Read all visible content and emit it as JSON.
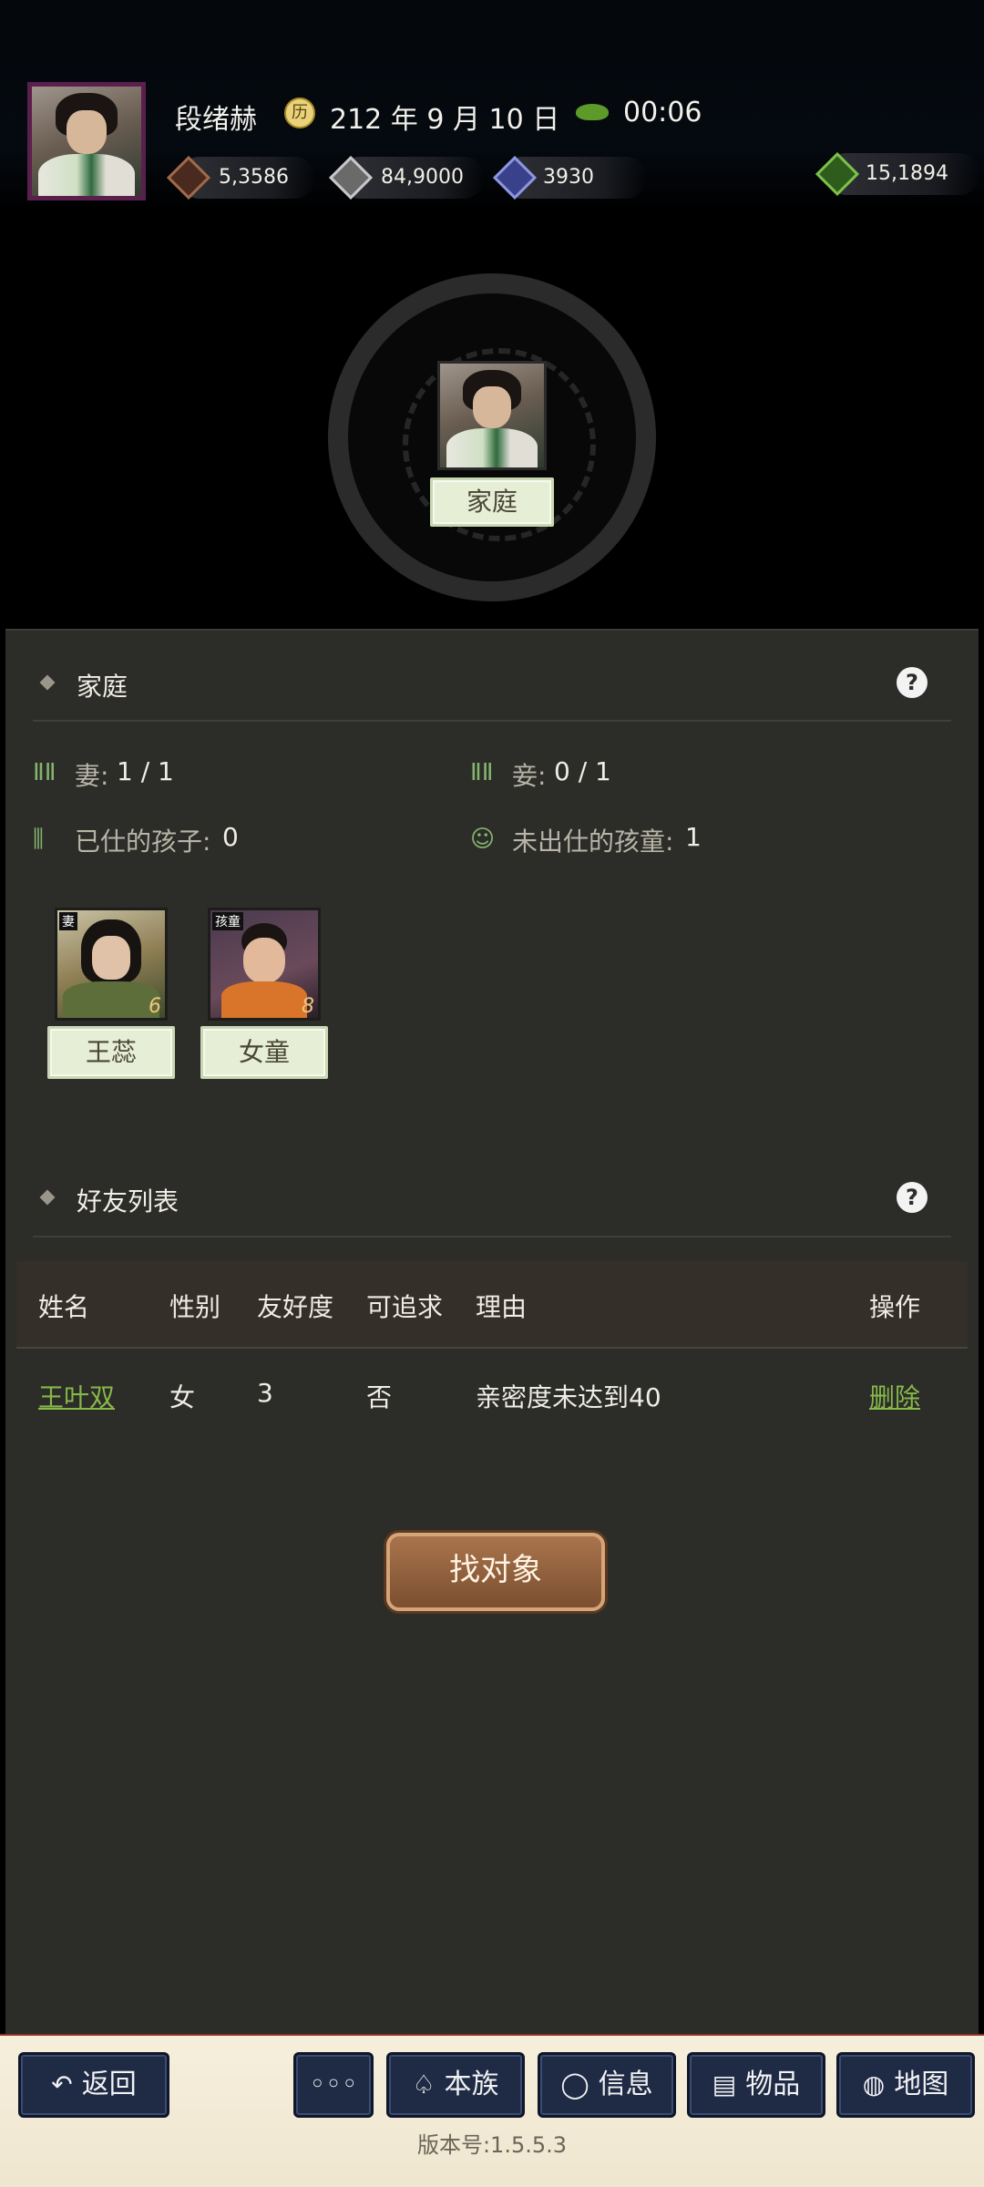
{
  "header": {
    "player_name": "段绪赫",
    "date": "212 年 9 月 10 日",
    "time": "00:06",
    "resources": [
      {
        "icon": "coin-icon",
        "value": "5,3586",
        "color": "#6a3c2a"
      },
      {
        "icon": "grain-icon",
        "value": "84,9000",
        "color": "#8f8f8f"
      },
      {
        "icon": "soldier-icon",
        "value": "3930",
        "color": "#4b56a8"
      },
      {
        "icon": "money-bag-icon",
        "value": "15,1894",
        "color": "#3e7a2a"
      }
    ]
  },
  "hero": {
    "label": "家庭"
  },
  "family": {
    "title": "家庭",
    "stats": [
      {
        "label": "妻:",
        "value": "1 / 1",
        "icon": "footprints-icon"
      },
      {
        "label": "妾:",
        "value": "0 / 1",
        "icon": "footprints-icon"
      },
      {
        "label": "已仕的孩子:",
        "value": "0",
        "icon": "people-icon"
      },
      {
        "label": "未出仕的孩童:",
        "value": "1",
        "icon": "baby-icon"
      }
    ],
    "members": [
      {
        "tag": "妻",
        "number": "6",
        "name": "王蕊"
      },
      {
        "tag": "孩童",
        "number": "8",
        "name": "女童"
      }
    ]
  },
  "friends": {
    "title": "好友列表",
    "columns": [
      "姓名",
      "性别",
      "友好度",
      "可追求",
      "理由",
      "操作"
    ],
    "rows": [
      {
        "name": "王叶双",
        "gender": "女",
        "friendliness": "3",
        "pursuable": "否",
        "reason": "亲密度未达到40",
        "action": "删除"
      }
    ]
  },
  "find_button": "找对象",
  "nav": {
    "back": "返回",
    "more": "◦◦◦",
    "clan": "本族",
    "info": "信息",
    "items": "物品",
    "map": "地图"
  },
  "version": "版本号:1.5.5.3"
}
